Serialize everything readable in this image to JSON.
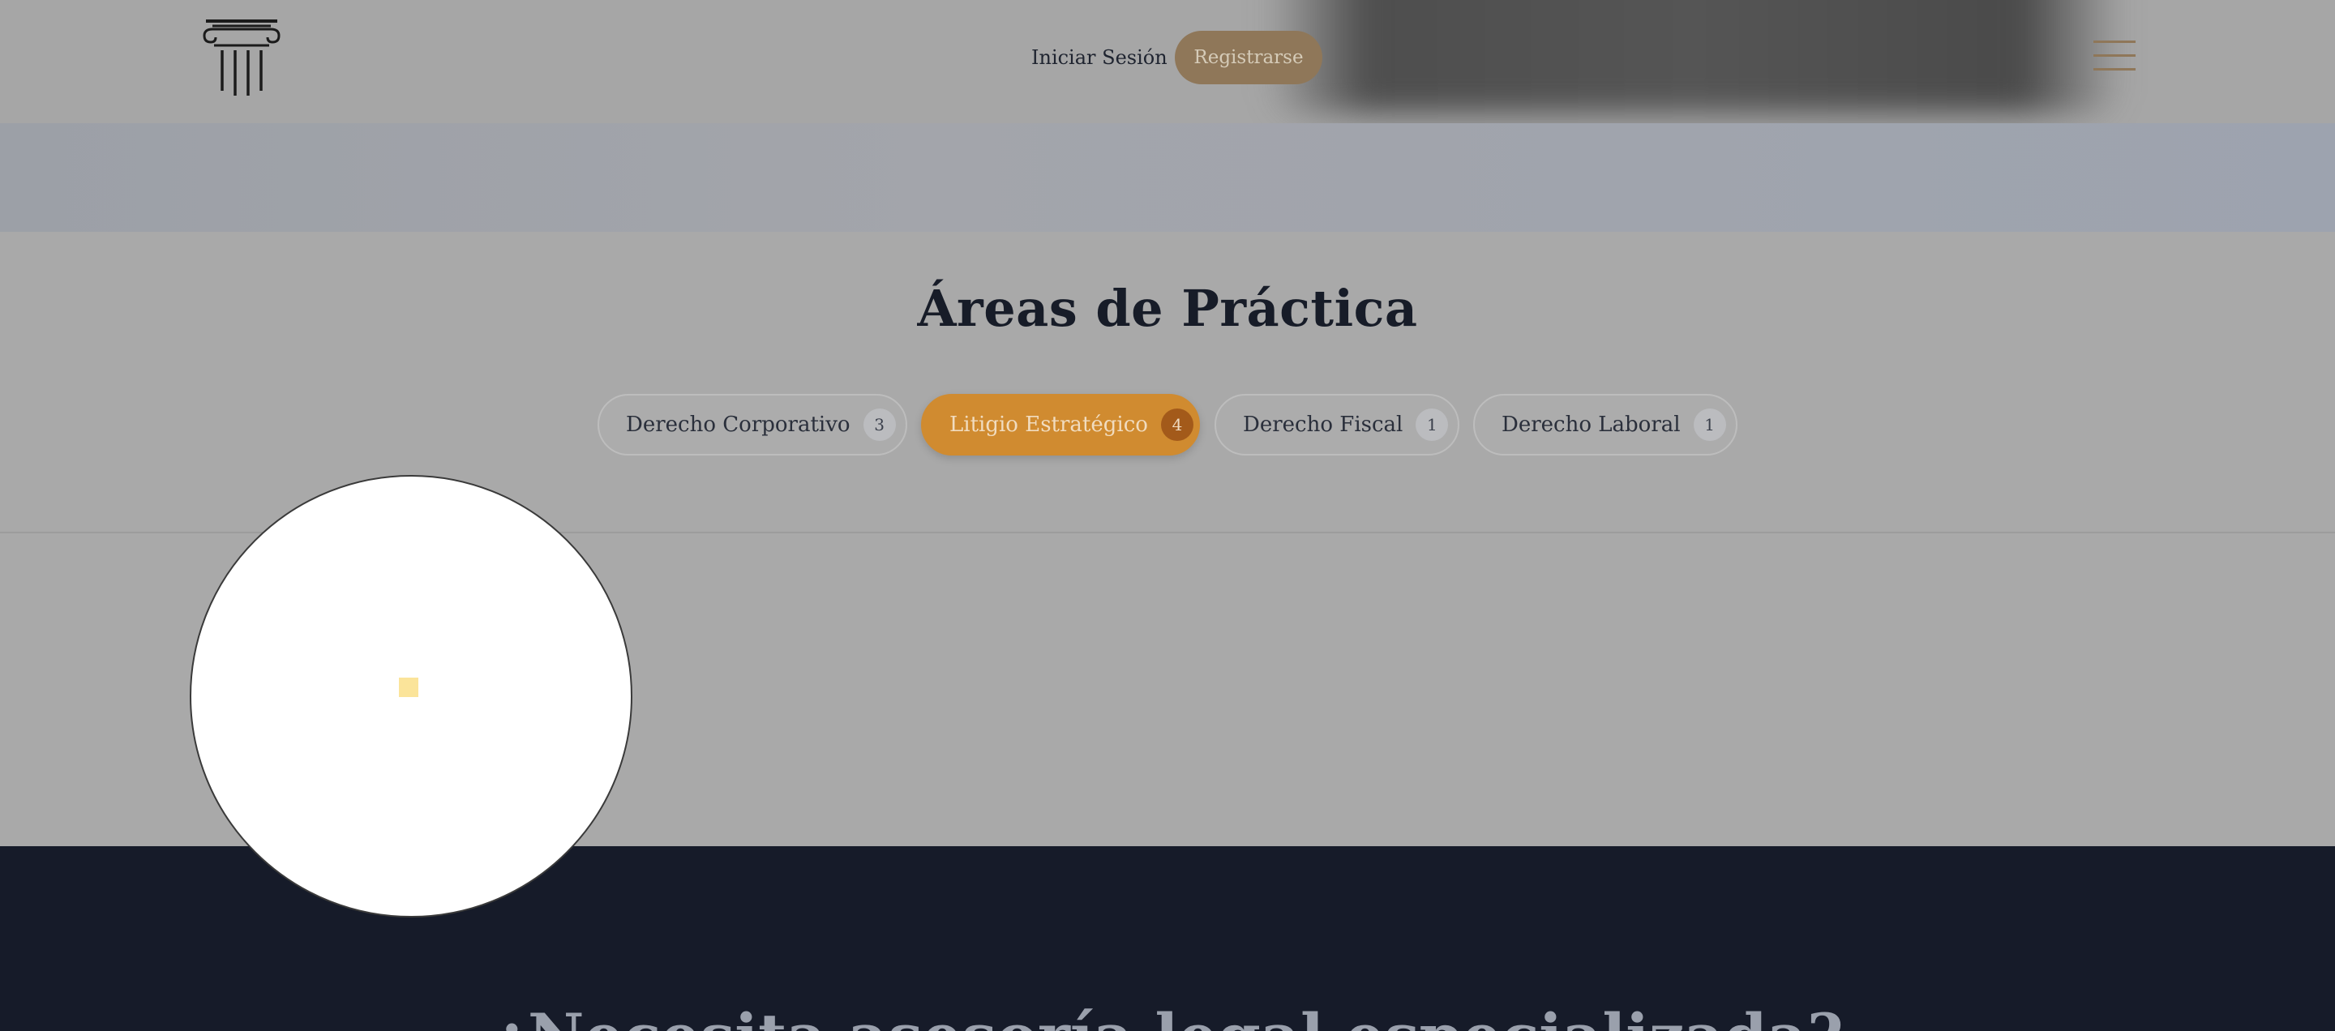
{
  "header": {
    "logo_icon": "greek-column-icon",
    "login_label": "Iniciar Sesión",
    "register_label": "Registrarse",
    "menu_icon": "hamburger-menu-icon"
  },
  "practice_areas": {
    "title": "Áreas de Práctica",
    "tabs": [
      {
        "label": "Derecho Corporativo",
        "count": "3",
        "active": false
      },
      {
        "label": "Litigio Estratégico",
        "count": "4",
        "active": true
      },
      {
        "label": "Derecho Fiscal",
        "count": "1",
        "active": false
      },
      {
        "label": "Derecho Laboral",
        "count": "1",
        "active": false
      }
    ]
  },
  "cta": {
    "title": "¿Necesita asesoría legal especializada?"
  },
  "colors": {
    "accent": "#d08b30",
    "dark": "#161b29",
    "muted_gold": "#8f7759"
  }
}
